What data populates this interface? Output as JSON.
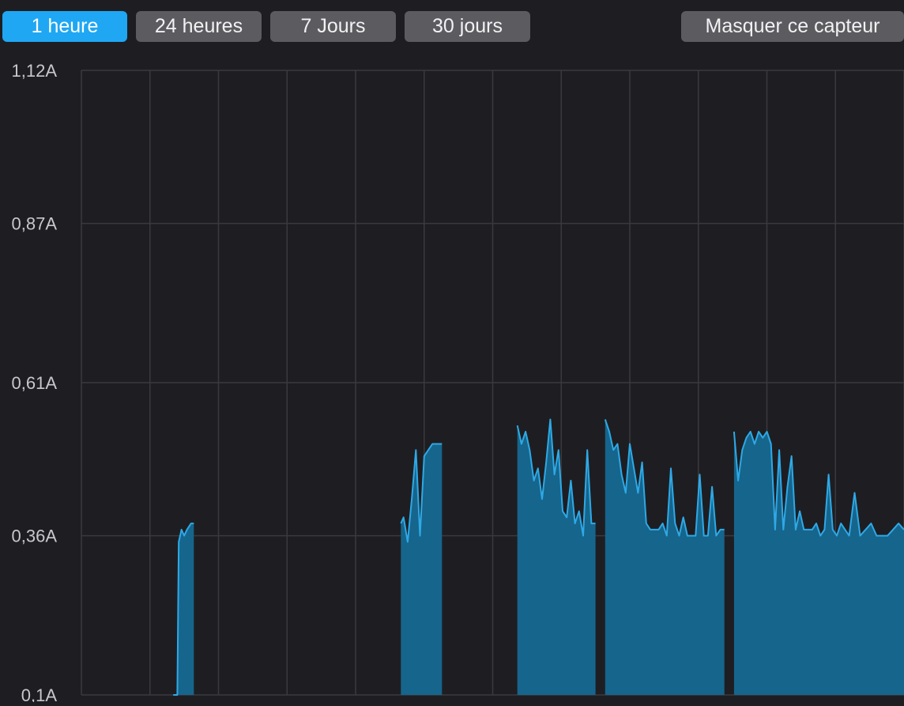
{
  "toolbar": {
    "ranges": [
      {
        "label": "1 heure",
        "active": true
      },
      {
        "label": "24 heures",
        "active": false
      },
      {
        "label": "7 Jours",
        "active": false
      },
      {
        "label": "30 jours",
        "active": false
      }
    ],
    "hide_label": "Masquer ce capteur"
  },
  "colors": {
    "background": "#1e1e22",
    "button": "#5c5c60",
    "button_active": "#1fa7f3",
    "grid": "#3a3a3e",
    "tick_label": "#c8c8cc",
    "area_fill": "#16658c",
    "line": "#2ea9e6"
  },
  "chart_data": {
    "type": "area",
    "title": "",
    "xlabel": "",
    "ylabel": "",
    "y_tick_labels": [
      "0,1A",
      "0,36A",
      "0,61A",
      "0,87A",
      "1,12A"
    ],
    "y_ticks": [
      0.1,
      0.36,
      0.61,
      0.87,
      1.12
    ],
    "ylim": [
      0.1,
      1.12
    ],
    "x_range": [
      0,
      60
    ],
    "x_vertical_gridlines": 12,
    "grid": true,
    "unit": "A",
    "segments": [
      {
        "x": [
          6.7,
          7.0,
          7.1,
          7.3,
          7.5,
          7.7,
          8.0,
          8.2
        ],
        "y": [
          0.1,
          0.1,
          0.35,
          0.37,
          0.36,
          0.37,
          0.38,
          0.38
        ]
      },
      {
        "x": [
          23.3,
          23.5,
          23.8,
          24.1,
          24.4,
          24.7,
          25.0,
          25.3,
          25.6,
          25.9,
          26.3
        ],
        "y": [
          0.38,
          0.39,
          0.35,
          0.42,
          0.5,
          0.36,
          0.49,
          0.5,
          0.51,
          0.51,
          0.51
        ]
      },
      {
        "x": [
          31.8,
          32.1,
          32.4,
          32.7,
          33.0,
          33.3,
          33.6,
          33.9,
          34.2,
          34.5,
          34.8,
          35.1,
          35.4,
          35.7,
          36.0,
          36.3,
          36.6,
          36.9,
          37.2,
          37.5
        ],
        "y": [
          0.54,
          0.51,
          0.53,
          0.5,
          0.45,
          0.47,
          0.42,
          0.48,
          0.55,
          0.46,
          0.5,
          0.4,
          0.39,
          0.45,
          0.38,
          0.4,
          0.36,
          0.5,
          0.38,
          0.38
        ]
      },
      {
        "x": [
          38.2,
          38.5,
          38.8,
          39.1,
          39.4,
          39.7,
          40.0,
          40.3,
          40.6,
          40.9,
          41.2,
          41.5,
          41.8,
          42.1,
          42.4,
          42.7,
          43.0,
          43.3,
          43.6,
          43.9,
          44.2,
          44.5,
          44.8,
          45.1,
          45.4,
          45.7,
          46.0,
          46.3,
          46.6,
          46.9
        ],
        "y": [
          0.55,
          0.53,
          0.5,
          0.51,
          0.46,
          0.43,
          0.51,
          0.47,
          0.43,
          0.48,
          0.38,
          0.37,
          0.37,
          0.37,
          0.38,
          0.36,
          0.47,
          0.38,
          0.36,
          0.39,
          0.36,
          0.36,
          0.36,
          0.46,
          0.36,
          0.36,
          0.44,
          0.36,
          0.37,
          0.37
        ]
      },
      {
        "x": [
          47.6,
          47.9,
          48.2,
          48.5,
          48.8,
          49.1,
          49.4,
          49.7,
          50.0,
          50.3,
          50.6,
          50.9,
          51.2,
          51.5,
          51.8,
          52.1,
          52.4,
          52.7,
          53.0,
          53.3,
          53.6,
          53.9,
          54.2,
          54.5,
          54.8,
          55.1,
          55.4,
          55.7,
          56.0,
          56.4,
          56.8,
          57.2,
          57.6,
          58.0,
          58.4,
          58.8,
          59.2,
          59.6,
          60.0
        ],
        "y": [
          0.53,
          0.45,
          0.5,
          0.52,
          0.53,
          0.51,
          0.53,
          0.52,
          0.53,
          0.51,
          0.37,
          0.5,
          0.37,
          0.44,
          0.49,
          0.37,
          0.4,
          0.37,
          0.37,
          0.37,
          0.38,
          0.36,
          0.37,
          0.46,
          0.37,
          0.36,
          0.38,
          0.37,
          0.36,
          0.43,
          0.36,
          0.37,
          0.38,
          0.36,
          0.36,
          0.36,
          0.37,
          0.38,
          0.37
        ]
      }
    ]
  }
}
